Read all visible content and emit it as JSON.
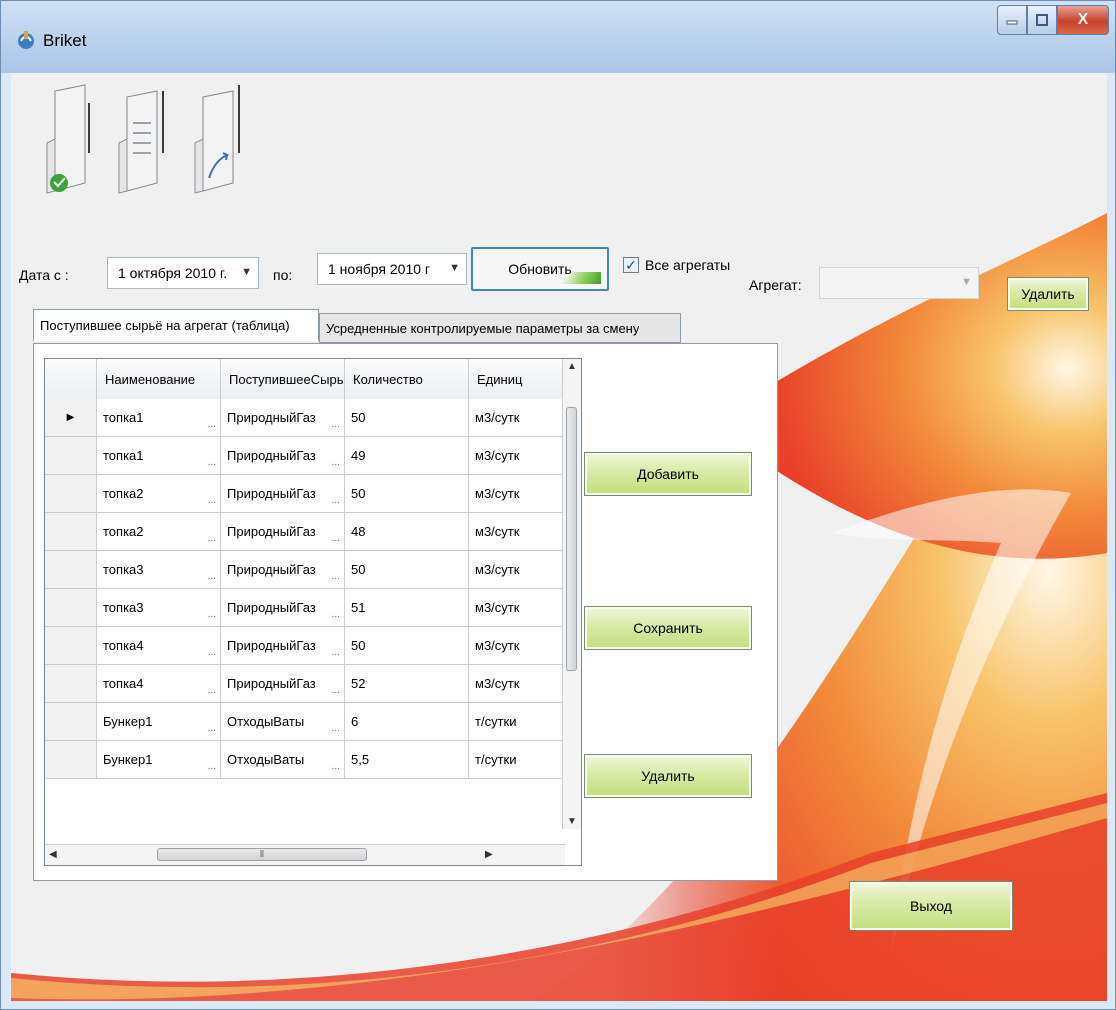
{
  "window": {
    "title": "Briket",
    "close_glyph": "X"
  },
  "toolbar": {
    "buttons": [
      {
        "icon": "document-import-icon"
      },
      {
        "icon": "document-list-icon"
      },
      {
        "icon": "document-export-icon"
      }
    ]
  },
  "filter": {
    "date_from_label": "Дата с :",
    "date_from_value": "1 октября 2010 г.",
    "date_to_label": "по:",
    "date_to_value": "1 ноября  2010 г",
    "refresh_label": "Обновить",
    "all_units_label": "Все агрегаты",
    "all_units_checked": true,
    "unit_label": "Агрегат:",
    "unit_value": "",
    "delete_top_label": "Удалить"
  },
  "tabs": [
    {
      "label": "Поступившее сырьё на агрегат (таблица)",
      "active": true
    },
    {
      "label": "Усредненные  контролируемые параметры за смену",
      "active": false
    }
  ],
  "grid": {
    "columns": [
      "Наименование",
      "ПоступившееСырь",
      "Количество",
      "Единиц"
    ],
    "rows": [
      {
        "name": "топка1",
        "material": "ПриродныйГаз",
        "qty": "50",
        "unit": "м3/сутк",
        "current": true
      },
      {
        "name": "топка1",
        "material": "ПриродныйГаз",
        "qty": "49",
        "unit": "м3/сутк",
        "current": false
      },
      {
        "name": "топка2",
        "material": "ПриродныйГаз",
        "qty": "50",
        "unit": "м3/сутк",
        "current": false
      },
      {
        "name": "топка2",
        "material": "ПриродныйГаз",
        "qty": "48",
        "unit": "м3/сутк",
        "current": false
      },
      {
        "name": "топка3",
        "material": "ПриродныйГаз",
        "qty": "50",
        "unit": "м3/сутк",
        "current": false
      },
      {
        "name": "топка3",
        "material": "ПриродныйГаз",
        "qty": "51",
        "unit": "м3/сутк",
        "current": false
      },
      {
        "name": "топка4",
        "material": "ПриродныйГаз",
        "qty": "50",
        "unit": "м3/сутк",
        "current": false
      },
      {
        "name": "топка4",
        "material": "ПриродныйГаз",
        "qty": "52",
        "unit": "м3/сутк",
        "current": false
      },
      {
        "name": "Бункер1",
        "material": "ОтходыВаты",
        "qty": "6",
        "unit": "т/сутки",
        "current": false
      },
      {
        "name": "Бункер1",
        "material": "ОтходыВаты",
        "qty": "5,5",
        "unit": "т/сутки",
        "current": false
      }
    ]
  },
  "actions": {
    "add_label": "Добавить",
    "save_label": "Сохранить",
    "delete_label": "Удалить",
    "exit_label": "Выход"
  },
  "colors": {
    "accent_green": "#c2de7c",
    "focus_blue": "#3d86c8",
    "swoosh_orange": "#f29a3a",
    "swoosh_red": "#e8402a"
  }
}
